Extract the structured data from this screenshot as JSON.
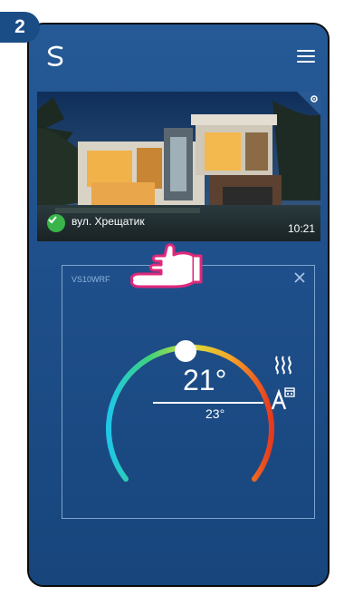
{
  "step": {
    "number": "2"
  },
  "house": {
    "address": "вул. Хрещатик",
    "time": "10:21"
  },
  "device": {
    "name": "VS10WRF",
    "current_temp": "21°",
    "set_temp": "23°"
  },
  "icons": {
    "logo": "s-logo-icon",
    "menu": "hamburger-menu-icon",
    "settings": "gear-icon",
    "connected": "check-circle-icon",
    "close": "close-icon",
    "heating": "heating-waves-icon",
    "mode": "auto-schedule-icon",
    "pointer": "pointing-hand-icon"
  },
  "colors": {
    "background": "#20538e",
    "badge": "#1a4d86",
    "check": "#3ab54a",
    "hand_outline": "#e0287a"
  }
}
